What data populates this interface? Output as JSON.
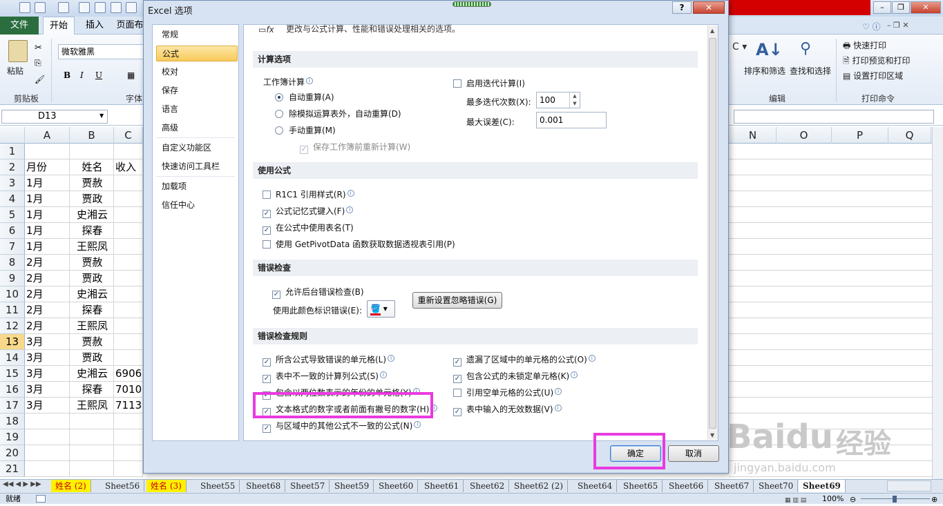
{
  "ribbon": {
    "file_tab": "文件",
    "tabs": [
      "开始",
      "插入",
      "页面布"
    ],
    "clipboard_label": "剪贴板",
    "paste_label": "粘贴",
    "font_name": "微软雅黑",
    "font_group_label": "字体",
    "sort_filter": "排序和筛选",
    "find_select": "查找和选择",
    "editing_label": "编辑",
    "quick_print": "快速打印",
    "print_preview": "打印预览和打印",
    "set_print_area": "设置打印区域",
    "print_cmd_label": "打印命令"
  },
  "formula": {
    "name_box": "D13"
  },
  "sheet": {
    "columns_left": [
      "A",
      "B",
      "C"
    ],
    "columns_right": [
      "N",
      "O",
      "P",
      "Q"
    ],
    "rows": [
      "1",
      "2",
      "3",
      "4",
      "5",
      "6",
      "7",
      "8",
      "9",
      "10",
      "11",
      "12",
      "13",
      "14",
      "15",
      "16",
      "17",
      "18",
      "19",
      "20",
      "21"
    ],
    "header": [
      "月份",
      "姓名",
      "收入"
    ],
    "data": [
      [
        "1月",
        "贾赦",
        ""
      ],
      [
        "1月",
        "贾政",
        ""
      ],
      [
        "1月",
        "史湘云",
        ""
      ],
      [
        "1月",
        "探春",
        ""
      ],
      [
        "1月",
        "王熙凤",
        ""
      ],
      [
        "2月",
        "贾赦",
        ""
      ],
      [
        "2月",
        "贾政",
        ""
      ],
      [
        "2月",
        "史湘云",
        ""
      ],
      [
        "2月",
        "探春",
        ""
      ],
      [
        "2月",
        "王熙凤",
        ""
      ],
      [
        "3月",
        "贾赦",
        ""
      ],
      [
        "3月",
        "贾政",
        ""
      ],
      [
        "3月",
        "史湘云",
        "6906"
      ],
      [
        "3月",
        "探春",
        "7010"
      ],
      [
        "3月",
        "王熙凤",
        "7113"
      ]
    ]
  },
  "sheet_tabs": [
    "姓名 (2)",
    "Sheet56",
    "姓名 (3)",
    "Sheet55",
    "Sheet68",
    "Sheet57",
    "Sheet59",
    "Sheet60",
    "Sheet61",
    "Sheet62",
    "Sheet62 (2)",
    "Sheet64",
    "Sheet65",
    "Sheet66",
    "Sheet67",
    "Sheet70",
    "Sheet69"
  ],
  "status": {
    "ready": "就绪",
    "zoom": "100%"
  },
  "dialog": {
    "title": "Excel 选项",
    "nav": [
      "常规",
      "公式",
      "校对",
      "保存",
      "语言",
      "高级",
      "自定义功能区",
      "快速访问工具栏",
      "加载项",
      "信任中心"
    ],
    "top_text": "更改与公式计算、性能和错误处理相关的选项。",
    "calc": {
      "header": "计算选项",
      "workbook_calc": "工作簿计算",
      "auto": "自动重算(A)",
      "auto_except": "除模拟运算表外，自动重算(D)",
      "manual": "手动重算(M)",
      "recalc_before_save": "保存工作簿前重新计算(W)",
      "iterative": "启用迭代计算(I)",
      "max_iter_label": "最多迭代次数(X):",
      "max_iter": "100",
      "max_change_label": "最大误差(C):",
      "max_change": "0.001"
    },
    "formulas": {
      "header": "使用公式",
      "r1c1": "R1C1 引用样式(R)",
      "autocomplete": "公式记忆式键入(F)",
      "table_names": "在公式中使用表名(T)",
      "pivot": "使用 GetPivotData 函数获取数据透视表引用(P)"
    },
    "errcheck": {
      "header": "错误检查",
      "enable_bg": "允许后台错误检查(B)",
      "color_label": "使用此颜色标识错误(E):",
      "reset_btn": "重新设置忽略错误(G)"
    },
    "rules": {
      "header": "错误检查规则",
      "left": [
        "所含公式导致错误的单元格(L)",
        "表中不一致的计算列公式(S)",
        "包含以两位数表示的年份的单元格(Y)",
        "文本格式的数字或者前面有撇号的数字(H)",
        "与区域中的其他公式不一致的公式(N)"
      ],
      "right": [
        "遗漏了区域中的单元格的公式(O)",
        "包含公式的未锁定单元格(K)",
        "引用空单元格的公式(U)",
        "表中输入的无效数据(V)"
      ]
    },
    "ok": "确定",
    "cancel": "取消"
  },
  "watermark": {
    "brand": "Baidu",
    "cn": "经验",
    "url": "jingyan.baidu.com"
  },
  "colors": {
    "highlight": "#e93ae0",
    "file_tab": "#2a6e3f",
    "active_nav": "#f7ca5a"
  }
}
